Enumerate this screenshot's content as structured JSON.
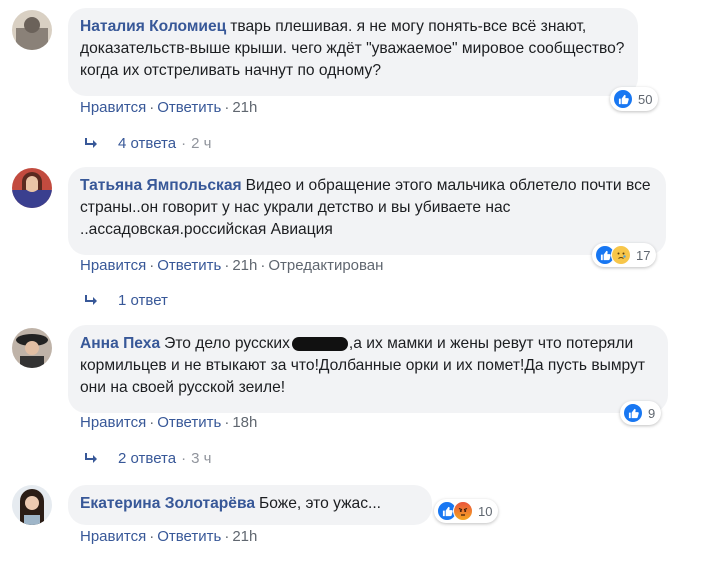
{
  "comments": [
    {
      "author": "Наталия Коломиец",
      "text": "тварь плешивая. я не могу понять-все всё знают, доказательств-выше крыши. чего ждёт \"уважаемое\" мировое сообщество? когда их отстреливать начнут по одному?",
      "reactions": {
        "icons": [
          "like-icon"
        ],
        "count": "50"
      },
      "actions": {
        "like": "Нравится",
        "reply": "Ответить",
        "time": "21h",
        "extra": ""
      },
      "replies": {
        "label": "4 ответа",
        "time": "2 ч"
      }
    },
    {
      "author": "Татьяна Ямпольская",
      "text": "Видео и обращение этого мальчика облетело почти все страны..он говорит у нас украли детство и вы убиваете нас ..ассадовская.российская Авиация",
      "reactions": {
        "icons": [
          "like-icon",
          "sad-icon"
        ],
        "count": "17"
      },
      "actions": {
        "like": "Нравится",
        "reply": "Ответить",
        "time": "21h",
        "extra": "Отредактирован"
      },
      "replies": {
        "label": "1 ответ",
        "time": ""
      }
    },
    {
      "author": "Анна Пеха",
      "text_before": "Это дело русских",
      "text_after": ",а их мамки и жены ревут что потеряли кормильцев и не втыкают за что!Долбанные орки и их помет!Да пусть вымрут они на своей русской зеиле!",
      "reactions": {
        "icons": [
          "like-icon"
        ],
        "count": "9"
      },
      "actions": {
        "like": "Нравится",
        "reply": "Ответить",
        "time": "18h",
        "extra": ""
      },
      "replies": {
        "label": "2 ответа",
        "time": "3 ч"
      }
    },
    {
      "author": "Екатерина Золотарёва",
      "text": "Боже, это ужас...",
      "reactions": {
        "icons": [
          "like-icon",
          "angry-icon"
        ],
        "count": "10"
      },
      "actions": {
        "like": "Нравится",
        "reply": "Ответить",
        "time": "21h",
        "extra": ""
      }
    }
  ],
  "colors": {
    "link": "#385898",
    "bubble": "#f2f3f5",
    "meta": "#606770",
    "like": "#1877f2"
  }
}
